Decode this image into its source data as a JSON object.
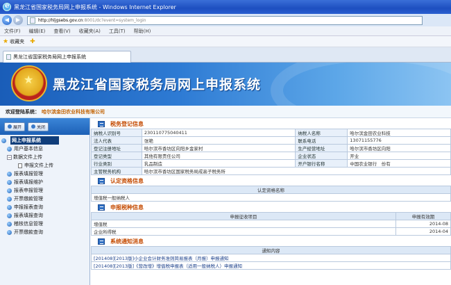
{
  "window": {
    "title": "黑龙江省国家税务局网上申报系统 - Windows Internet Explorer"
  },
  "address": {
    "host": "http://hljgsebs.gov.cn",
    "path": ":8001/dc?event=system_login"
  },
  "menu": [
    "文件(F)",
    "编辑(E)",
    "查看(V)",
    "收藏夹(A)",
    "工具(T)",
    "帮助(H)"
  ],
  "favorites": {
    "label": "收藏夹"
  },
  "tab": {
    "label": "黑龙江省国家税务局网上申报系统"
  },
  "banner": {
    "title": "黑龙江省国家税务局网上申报系统"
  },
  "welcome": {
    "label": "欢迎登陆系统：",
    "company": "哈尔滨金田农业科技有限公司"
  },
  "sidebar": {
    "buttons": [
      "展开",
      "关闭"
    ],
    "root": "网上申报系统",
    "items": [
      {
        "label": "用户基本信息",
        "level": 1,
        "kind": "ball"
      },
      {
        "label": "数据文件上传",
        "level": 1,
        "kind": "plus"
      },
      {
        "label": "申报文件上传",
        "level": 2,
        "kind": "doc"
      },
      {
        "label": "报表填报管理",
        "level": 1,
        "kind": "ball"
      },
      {
        "label": "报表填报维护",
        "level": 1,
        "kind": "ball"
      },
      {
        "label": "报表申报管理",
        "level": 1,
        "kind": "ball"
      },
      {
        "label": "开票缴款管理",
        "level": 1,
        "kind": "ball"
      },
      {
        "label": "申报报表查询",
        "level": 1,
        "kind": "ball"
      },
      {
        "label": "报表填报查询",
        "level": 1,
        "kind": "ball"
      },
      {
        "label": "稽核信息管理",
        "level": 1,
        "kind": "ball"
      },
      {
        "label": "开票缴款查询",
        "level": 1,
        "kind": "ball"
      }
    ]
  },
  "tax_registration": {
    "section_title": "税务登记信息",
    "rows": [
      [
        "纳税人识别号",
        "230110775040411",
        "纳税人名称",
        "哈尔滨金田农业科技"
      ],
      [
        "法人代表",
        "张艳",
        "联系电话",
        "13071155776"
      ],
      [
        "登记注册地址",
        "哈尔滨市香坊区向阳乡金家村",
        "生产经营地址",
        "哈尔滨市香坊区向阳"
      ],
      [
        "登记类型",
        "其他有限责任公司",
        "企业状态",
        "开业"
      ],
      [
        "行业类别",
        "乳品制造",
        "开户银行名称",
        "中国农业银行　份有"
      ]
    ],
    "authority_label": "主管税务机构",
    "authority_value": "哈尔滨市香坊区国家税务局成高子税务所"
  },
  "qualification": {
    "section_title": "认定资格信息",
    "header": "认定资格名称",
    "value": "增值税一般纳税人"
  },
  "declaration_types": {
    "section_title": "申报税种信息",
    "headers": [
      "申报征收项目",
      "申报有效期"
    ],
    "rows": [
      [
        "增值税",
        "2014-08"
      ],
      [
        "企业所得税",
        "2014-04"
      ]
    ]
  },
  "notifications": {
    "section_title": "系统通知消息",
    "header": "通知内容",
    "rows": [
      "[201408][2013版]小企业会计财务准则简易报表（月报）申报通知",
      "[201408][2013版]《营改增》增值税申报表（适用一般纳税人）申报通知"
    ]
  }
}
